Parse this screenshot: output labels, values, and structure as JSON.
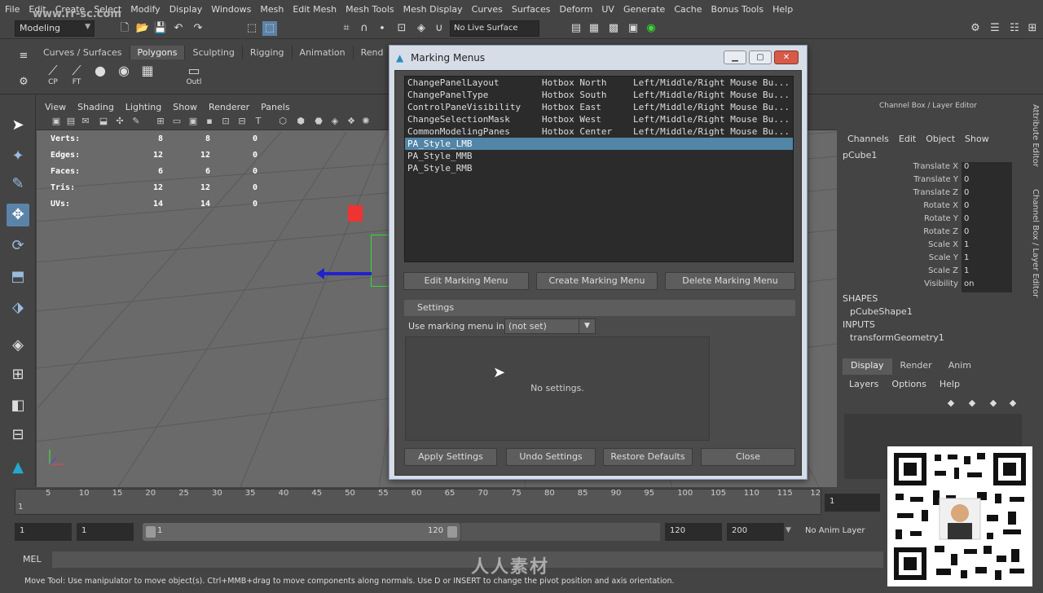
{
  "colors": {
    "selection_blue": "#5285a6",
    "dialog_body": "#4b4b4b",
    "viewport_grey": "#666666",
    "red_cube": "#e33333",
    "manip_blue": "#2222cc",
    "manip_green": "#33dd33"
  },
  "watermark_top": "www.rr-sc.com",
  "watermark_bottom": "人人素材",
  "menubar": [
    "File",
    "Edit",
    "Create",
    "Select",
    "Modify",
    "Display",
    "Windows",
    "Mesh",
    "Edit Mesh",
    "Mesh Tools",
    "Mesh Display",
    "Curves",
    "Surfaces",
    "Deform",
    "UV",
    "Generate",
    "Cache",
    "Bonus Tools",
    "Help"
  ],
  "statusline": {
    "mode": "Modeling",
    "live_surface": "No Live Surface"
  },
  "shelf": {
    "tabs": [
      "Curves / Surfaces",
      "Polygons",
      "Sculpting",
      "Rigging",
      "Animation",
      "Rend"
    ],
    "icons": [
      {
        "label": "CP",
        "icon": "cp-icon"
      },
      {
        "label": "FT",
        "icon": "ft-icon"
      },
      {
        "label": "",
        "icon": "sphere-icon"
      },
      {
        "label": "",
        "icon": "eye-icon"
      },
      {
        "label": "",
        "icon": "checker-icon"
      },
      {
        "label": "Outl",
        "icon": "outliner-icon"
      }
    ]
  },
  "viewport": {
    "menu": [
      "View",
      "Shading",
      "Lighting",
      "Show",
      "Renderer",
      "Panels"
    ],
    "hud": [
      {
        "label": "Verts:",
        "a": "8",
        "b": "8",
        "c": "0"
      },
      {
        "label": "Edges:",
        "a": "12",
        "b": "12",
        "c": "0"
      },
      {
        "label": "Faces:",
        "a": "6",
        "b": "6",
        "c": "0"
      },
      {
        "label": "Tris:",
        "a": "12",
        "b": "12",
        "c": "0"
      },
      {
        "label": "UVs:",
        "a": "14",
        "b": "14",
        "c": "0"
      }
    ]
  },
  "dialog": {
    "title": "Marking Menus",
    "menus": [
      {
        "name": "ChangePanelLayout",
        "hotbox": "Hotbox North",
        "mouse": "Left/Middle/Right Mouse Bu..."
      },
      {
        "name": "ChangePanelType",
        "hotbox": "Hotbox South",
        "mouse": "Left/Middle/Right Mouse Bu..."
      },
      {
        "name": "ControlPaneVisibility",
        "hotbox": "Hotbox East",
        "mouse": "Left/Middle/Right Mouse Bu..."
      },
      {
        "name": "ChangeSelectionMask",
        "hotbox": "Hotbox West",
        "mouse": "Left/Middle/Right Mouse Bu..."
      },
      {
        "name": "CommonModelingPanes",
        "hotbox": "Hotbox Center",
        "mouse": "Left/Middle/Right Mouse Bu..."
      },
      {
        "name": "PA_Style_LMB",
        "hotbox": "",
        "mouse": ""
      },
      {
        "name": "PA_Style_MMB",
        "hotbox": "",
        "mouse": ""
      },
      {
        "name": "PA_Style_RMB",
        "hotbox": "",
        "mouse": ""
      }
    ],
    "selected_index": 5,
    "buttons": {
      "edit": "Edit Marking Menu",
      "create": "Create Marking Menu",
      "delete": "Delete Marking Menu"
    },
    "settings_label": "Settings",
    "use_in_label": "Use marking menu in:",
    "use_in_value": "(not set)",
    "no_settings": "No settings.",
    "footer": {
      "apply": "Apply Settings",
      "undo": "Undo Settings",
      "restore": "Restore Defaults",
      "close": "Close"
    }
  },
  "channel_box": {
    "title": "Channel Box / Layer Editor",
    "menu": [
      "Channels",
      "Edit",
      "Object",
      "Show"
    ],
    "object": "pCube1",
    "attributes": [
      {
        "name": "Translate X",
        "value": "0"
      },
      {
        "name": "Translate Y",
        "value": "0"
      },
      {
        "name": "Translate Z",
        "value": "0"
      },
      {
        "name": "Rotate X",
        "value": "0"
      },
      {
        "name": "Rotate Y",
        "value": "0"
      },
      {
        "name": "Rotate Z",
        "value": "0"
      },
      {
        "name": "Scale X",
        "value": "1"
      },
      {
        "name": "Scale Y",
        "value": "1"
      },
      {
        "name": "Scale Z",
        "value": "1"
      },
      {
        "name": "Visibility",
        "value": "on"
      }
    ],
    "shapes_header": "SHAPES",
    "shape": "pCubeShape1",
    "inputs_header": "INPUTS",
    "input": "transformGeometry1",
    "side_tabs": [
      "Attribute Editor",
      "Channel Box / Layer Editor"
    ]
  },
  "layer_editor": {
    "tabs": [
      "Display",
      "Render",
      "Anim"
    ],
    "menu": [
      "Layers",
      "Options",
      "Help"
    ]
  },
  "timeline": {
    "ticks": [
      "5",
      "10",
      "15",
      "20",
      "25",
      "30",
      "35",
      "40",
      "45",
      "50",
      "55",
      "60",
      "65",
      "70",
      "75",
      "80",
      "85",
      "90",
      "95",
      "100",
      "105",
      "110",
      "115",
      "12"
    ],
    "start_marker": "1",
    "current_frame": "1"
  },
  "range": {
    "start": "1",
    "playback_start": "1",
    "slider_start": "1",
    "slider_end": "120",
    "playback_end": "120",
    "end": "200",
    "anim_layer": "No Anim Layer"
  },
  "mel": {
    "label": "MEL"
  },
  "help_line": "Move Tool: Use manipulator to move object(s). Ctrl+MMB+drag to move components along normals. Use D or INSERT to change the pivot position and axis orientation."
}
